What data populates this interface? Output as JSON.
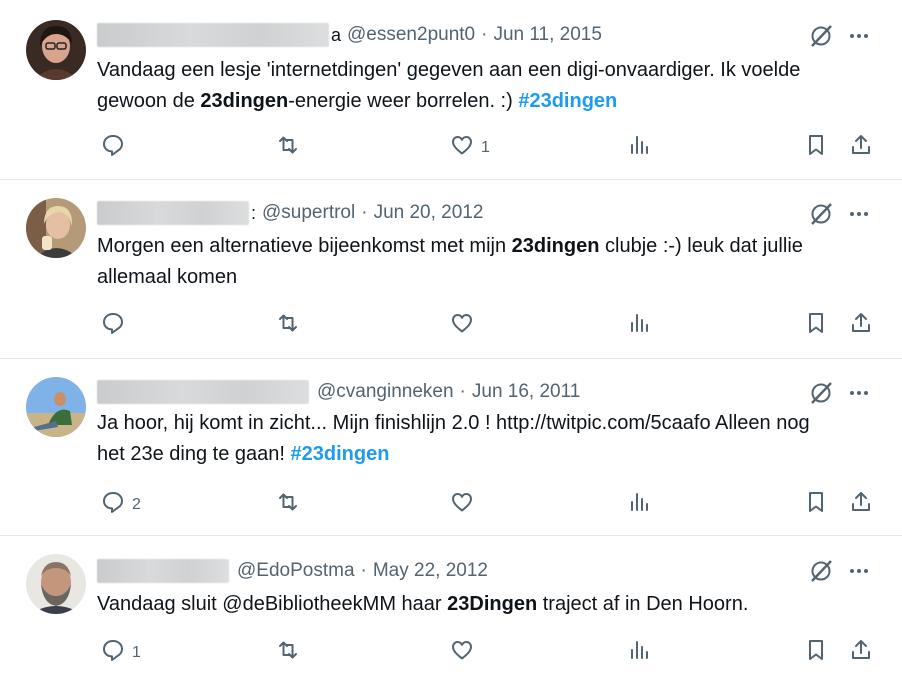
{
  "tweets": [
    {
      "name_tail": "a",
      "handle": "@essen2punt0",
      "separator": "·",
      "date": "Jun 11, 2015",
      "text": [
        {
          "t": "Vandaag een lesje 'internetdingen' gegeven aan een digi-onvaardiger. Ik voelde gewoon de ",
          "k": "plain"
        },
        {
          "t": "23dingen",
          "k": "bold"
        },
        {
          "t": "-energie weer borrelen. :) ",
          "k": "plain"
        },
        {
          "t": "#23dingen",
          "k": "hashtag"
        }
      ],
      "reply_count": "",
      "like_count": "1"
    },
    {
      "name_tail": ":",
      "handle": "@supertrol",
      "separator": "·",
      "date": "Jun 20, 2012",
      "text": [
        {
          "t": "Morgen een alternatieve bijeenkomst met mijn ",
          "k": "plain"
        },
        {
          "t": "23dingen",
          "k": "bold"
        },
        {
          "t": " clubje :-) leuk dat jullie allemaal komen",
          "k": "plain"
        }
      ],
      "reply_count": "",
      "like_count": ""
    },
    {
      "name_tail": "",
      "handle": "@cvanginneken",
      "separator": "·",
      "date": "Jun 16, 2011",
      "text": [
        {
          "t": "Ja hoor, hij komt in zicht...  Mijn finishlijn 2.0 ! http://twitpic.com/5caafo Alleen nog het 23e ding te gaan! ",
          "k": "plain"
        },
        {
          "t": "#23dingen",
          "k": "hashtag"
        }
      ],
      "reply_count": "2",
      "like_count": ""
    },
    {
      "name_tail": "",
      "handle": "@EdoPostma",
      "separator": "·",
      "date": "May 22, 2012",
      "text": [
        {
          "t": "Vandaag sluit @deBibliotheekMM haar ",
          "k": "plain"
        },
        {
          "t": "23Dingen",
          "k": "bold"
        },
        {
          "t": " traject af in Den Hoorn.",
          "k": "plain"
        }
      ],
      "reply_count": "1",
      "like_count": ""
    }
  ],
  "icons": {
    "reply": "reply-icon",
    "retweet": "retweet-icon",
    "like": "like-icon",
    "views": "views-icon",
    "bookmark": "bookmark-icon",
    "share": "share-icon",
    "grok": "grok-icon",
    "more": "more-icon"
  },
  "colors": {
    "hashtag": "#1d9bf0",
    "secondary_text": "#536471",
    "divider": "#e6e9ec"
  }
}
